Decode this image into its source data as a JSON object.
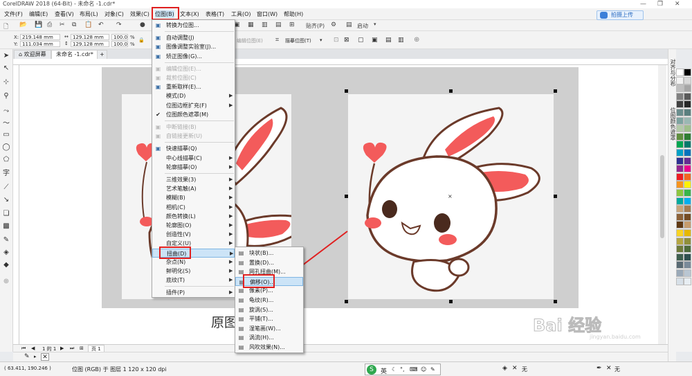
{
  "window": {
    "title": "CorelDRAW 2018 (64-Bit) - 未命名 -1.cdr*"
  },
  "menubar": {
    "items": [
      "文件(F)",
      "编辑(E)",
      "查看(V)",
      "布局(L)",
      "对象(C)",
      "效果(C)",
      "位图(B)",
      "文本(X)",
      "表格(T)",
      "工具(O)",
      "窗口(W)",
      "帮助(H)"
    ],
    "upload_label": "拍摄上传"
  },
  "toolbar1": {
    "paste_label": "贴齐(P)",
    "launch_label": "启动"
  },
  "property_bar": {
    "x_label": "X:",
    "x_value": "219.148 mm",
    "y_label": "Y:",
    "y_value": "111.034 mm",
    "w_value": "129.128 mm",
    "h_value": "129.128 mm",
    "scale_x": "100.0",
    "scale_y": "100.0",
    "pct": "%",
    "bitmap_trace_label": "描摹位图(T)",
    "edit_bitmap_label": "编辑位图(E)"
  },
  "tabs": {
    "welcome": "欢迎屏幕",
    "document": "未命名 -1.cdr*"
  },
  "canvas": {
    "caption": "原图"
  },
  "pagebar": {
    "page_info": "1 的 1",
    "page_tab": "页 1"
  },
  "status": {
    "coords": "( 63.411, 190.246 )",
    "object_info": "位图 (RGB) 于 图层 1 120 x 120 dpi",
    "ime_label": "英",
    "fill_none": "无",
    "outline_none": "无"
  },
  "dock": {
    "tab1": "对齐与分布",
    "tab2": "位图颜色遮罩"
  },
  "bitmap_menu": {
    "items": [
      {
        "label": "转换为位图...",
        "icon": "convert-icon",
        "disabled": false,
        "submenu": false,
        "checked": false
      },
      {
        "sep": true
      },
      {
        "label": "自动调整(J)",
        "icon": "auto-adjust-icon",
        "disabled": false,
        "submenu": false,
        "checked": false
      },
      {
        "label": "图像调整实验室(J)...",
        "icon": "image-lab-icon",
        "disabled": false,
        "submenu": false,
        "checked": false
      },
      {
        "label": "矫正图像(G)...",
        "icon": "straighten-icon",
        "disabled": false,
        "submenu": false,
        "checked": false
      },
      {
        "sep": true
      },
      {
        "label": "编辑位图(E)...",
        "icon": "edit-bitmap-icon",
        "disabled": true,
        "submenu": false,
        "checked": false
      },
      {
        "label": "裁剪位图(C)",
        "icon": "crop-bitmap-icon",
        "disabled": true,
        "submenu": false,
        "checked": false
      },
      {
        "label": "重新取样(E)...",
        "icon": "resample-icon",
        "disabled": false,
        "submenu": false,
        "checked": false
      },
      {
        "label": "模式(D)",
        "icon": "",
        "disabled": false,
        "submenu": true,
        "checked": false
      },
      {
        "label": "位图边框扩充(F)",
        "icon": "",
        "disabled": false,
        "submenu": true,
        "checked": false
      },
      {
        "label": "位图颜色遮罩(M)",
        "icon": "check-icon",
        "disabled": false,
        "submenu": false,
        "checked": true
      },
      {
        "sep": true
      },
      {
        "label": "中断链接(B)",
        "icon": "break-link-icon",
        "disabled": true,
        "submenu": false,
        "checked": false
      },
      {
        "label": "自链接更新(U)",
        "icon": "update-link-icon",
        "disabled": true,
        "submenu": false,
        "checked": false
      },
      {
        "sep": true
      },
      {
        "label": "快速描摹(Q)",
        "icon": "quick-trace-icon",
        "disabled": false,
        "submenu": false,
        "checked": false
      },
      {
        "label": "中心线描摹(C)",
        "icon": "",
        "disabled": false,
        "submenu": true,
        "checked": false
      },
      {
        "label": "轮廓描摹(O)",
        "icon": "",
        "disabled": false,
        "submenu": true,
        "checked": false
      },
      {
        "sep": true
      },
      {
        "label": "三维效果(3)",
        "icon": "",
        "disabled": false,
        "submenu": true,
        "checked": false
      },
      {
        "label": "艺术笔触(A)",
        "icon": "",
        "disabled": false,
        "submenu": true,
        "checked": false
      },
      {
        "label": "模糊(B)",
        "icon": "",
        "disabled": false,
        "submenu": true,
        "checked": false
      },
      {
        "label": "相机(C)",
        "icon": "",
        "disabled": false,
        "submenu": true,
        "checked": false
      },
      {
        "label": "颜色转换(L)",
        "icon": "",
        "disabled": false,
        "submenu": true,
        "checked": false
      },
      {
        "label": "轮廓图(O)",
        "icon": "",
        "disabled": false,
        "submenu": true,
        "checked": false
      },
      {
        "label": "创造性(V)",
        "icon": "",
        "disabled": false,
        "submenu": true,
        "checked": false
      },
      {
        "label": "自定义(U)",
        "icon": "",
        "disabled": false,
        "submenu": true,
        "checked": false
      },
      {
        "label": "扭曲(D)",
        "icon": "",
        "disabled": false,
        "submenu": true,
        "checked": false,
        "highlight": true
      },
      {
        "label": "杂点(N)",
        "icon": "",
        "disabled": false,
        "submenu": true,
        "checked": false
      },
      {
        "label": "鲜明化(S)",
        "icon": "",
        "disabled": false,
        "submenu": true,
        "checked": false
      },
      {
        "label": "底纹(T)",
        "icon": "",
        "disabled": false,
        "submenu": true,
        "checked": false
      },
      {
        "sep": true
      },
      {
        "label": "插件(P)",
        "icon": "",
        "disabled": false,
        "submenu": true,
        "checked": false
      }
    ]
  },
  "distort_menu": {
    "items": [
      {
        "label": "块状(B)...",
        "icon": "blocks-icon"
      },
      {
        "label": "置换(D)...",
        "icon": "displace-icon"
      },
      {
        "label": "网孔扭曲(M)...",
        "icon": "mesh-warp-icon"
      },
      {
        "label": "偏移(O)...",
        "icon": "offset-icon",
        "highlight": true
      },
      {
        "label": "像素(P)...",
        "icon": "pixelate-icon"
      },
      {
        "label": "龟纹(R)...",
        "icon": "ripple-icon"
      },
      {
        "label": "旋涡(S)...",
        "icon": "swirl-icon"
      },
      {
        "label": "平铺(T)...",
        "icon": "tile-icon"
      },
      {
        "label": "湿笔画(W)...",
        "icon": "wet-paint-icon"
      },
      {
        "label": "涡流(H)...",
        "icon": "whirlpool-icon"
      },
      {
        "label": "风吹效果(N)...",
        "icon": "wind-icon"
      }
    ]
  },
  "palette": {
    "colors": [
      "#ffffff",
      "#000000",
      "#f2f2f2",
      "#d9d9d9",
      "#bfbfbf",
      "#a6a6a6",
      "#808080",
      "#595959",
      "#404040",
      "#262626",
      "#6b8e8e",
      "#5a7f7f",
      "#7da3a0",
      "#9ab8b3",
      "#b2c9a8",
      "#9fbf8c",
      "#5f8f3f",
      "#2e7d32",
      "#00a651",
      "#00796b",
      "#00a0c6",
      "#0072bc",
      "#2e3192",
      "#662d91",
      "#92278f",
      "#ec008c",
      "#ed1c24",
      "#f26522",
      "#f7941d",
      "#fff200",
      "#8dc63f",
      "#39b54a",
      "#00a99d",
      "#00aeef",
      "#c7a37a",
      "#a67c52",
      "#8c6239",
      "#754c24",
      "#603913",
      "#c69c6d",
      "#f9d423",
      "#e6b800",
      "#b5a642",
      "#8f8f3a",
      "#6e7b3b",
      "#4e6b3b",
      "#3f5f4f",
      "#2f4f4f",
      "#596a73",
      "#7a8a99",
      "#9aa9b8",
      "#b9c6d2",
      "#d7e0e8",
      "#e8eef3"
    ]
  },
  "watermark": {
    "brand": "Bai 经验",
    "url": "jingyan.baidu.com"
  }
}
